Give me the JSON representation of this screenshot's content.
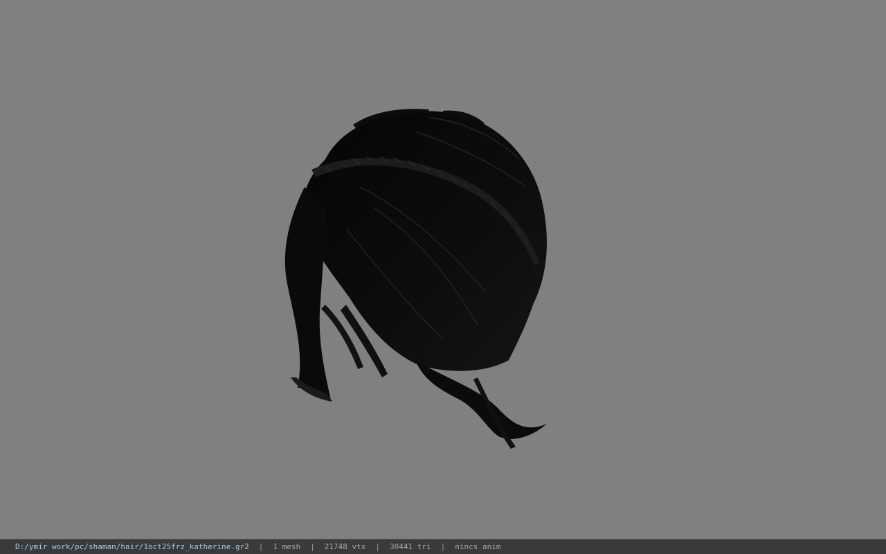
{
  "viewer": {
    "background_color": "#808080",
    "model_icon": "hair-mesh-model"
  },
  "statusbar": {
    "file_path": "D:/ymir work/pc/shaman/hair/1oct25frz_katherine.gr2",
    "separator": "|",
    "mesh_count": "1 mesh",
    "vertex_count": "21748 vtx",
    "triangle_count": "30441 tri",
    "anim_status": "nincs anim",
    "path_color": "#9fd0e6",
    "text_color": "#a8a8a8"
  }
}
